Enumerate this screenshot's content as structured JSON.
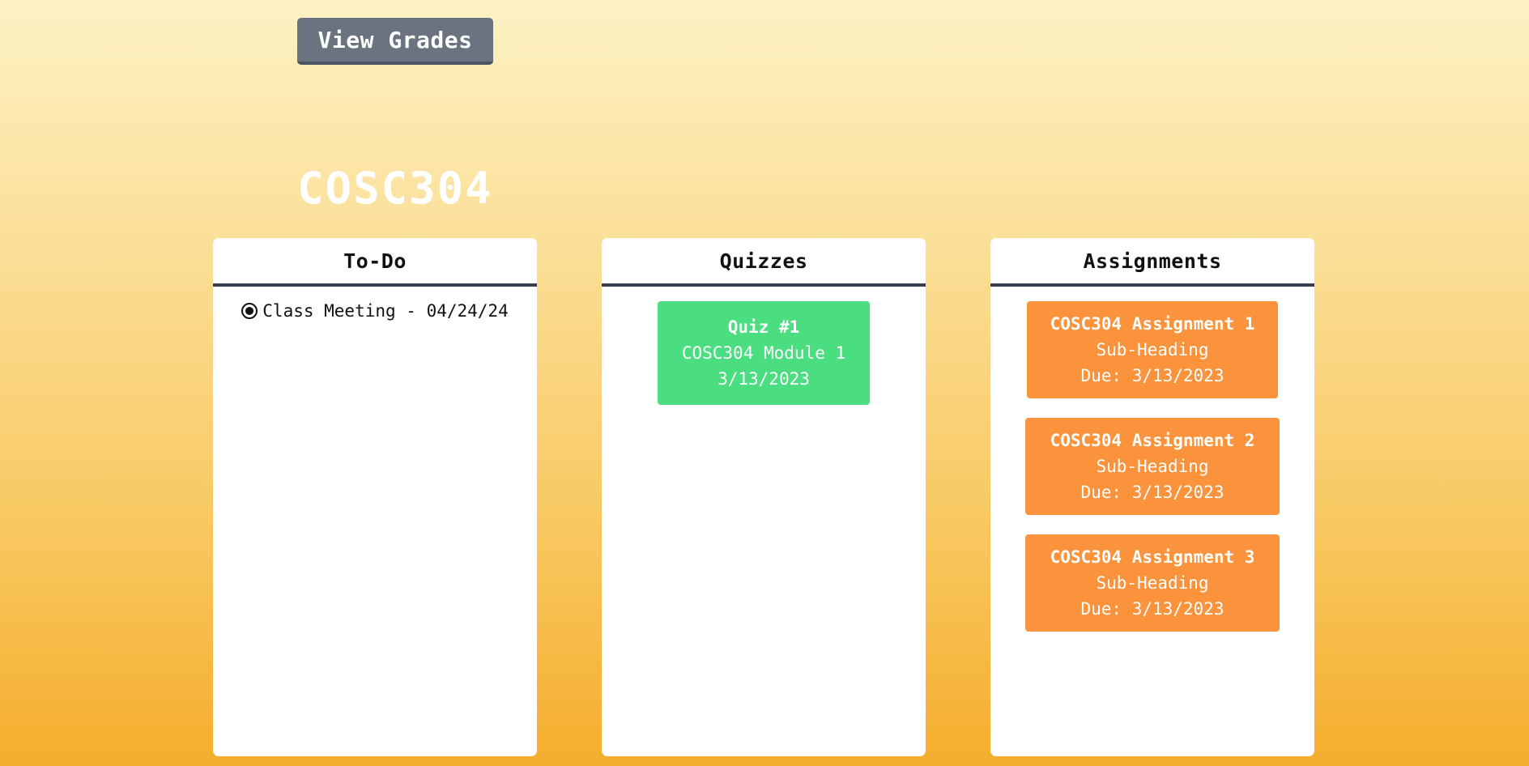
{
  "header": {
    "grades_button_label": "View Grades",
    "course_title": "COSC304"
  },
  "todo": {
    "heading": "To-Do",
    "items": [
      {
        "label": "Class Meeting - 04/24/24"
      }
    ]
  },
  "quizzes": {
    "heading": "Quizzes",
    "items": [
      {
        "title": "Quiz #1",
        "subtitle": "COSC304 Module 1",
        "date": "3/13/2023"
      }
    ]
  },
  "assignments": {
    "heading": "Assignments",
    "items": [
      {
        "title": "COSC304 Assignment 1",
        "subtitle": "Sub-Heading",
        "due": "Due: 3/13/2023"
      },
      {
        "title": "COSC304 Assignment 2",
        "subtitle": "Sub-Heading",
        "due": "Due: 3/13/2023"
      },
      {
        "title": "COSC304 Assignment 3",
        "subtitle": "Sub-Heading",
        "due": "Due: 3/13/2023"
      }
    ]
  },
  "colors": {
    "button_bg": "#6b7280",
    "quiz_card": "#4ade80",
    "assignment_card": "#fb923c",
    "header_divider": "#374151",
    "background_top": "#fdf2c4",
    "background_bottom": "#f5ad2d"
  },
  "icons": {
    "todo_item_icon": "radio-selected-icon"
  }
}
